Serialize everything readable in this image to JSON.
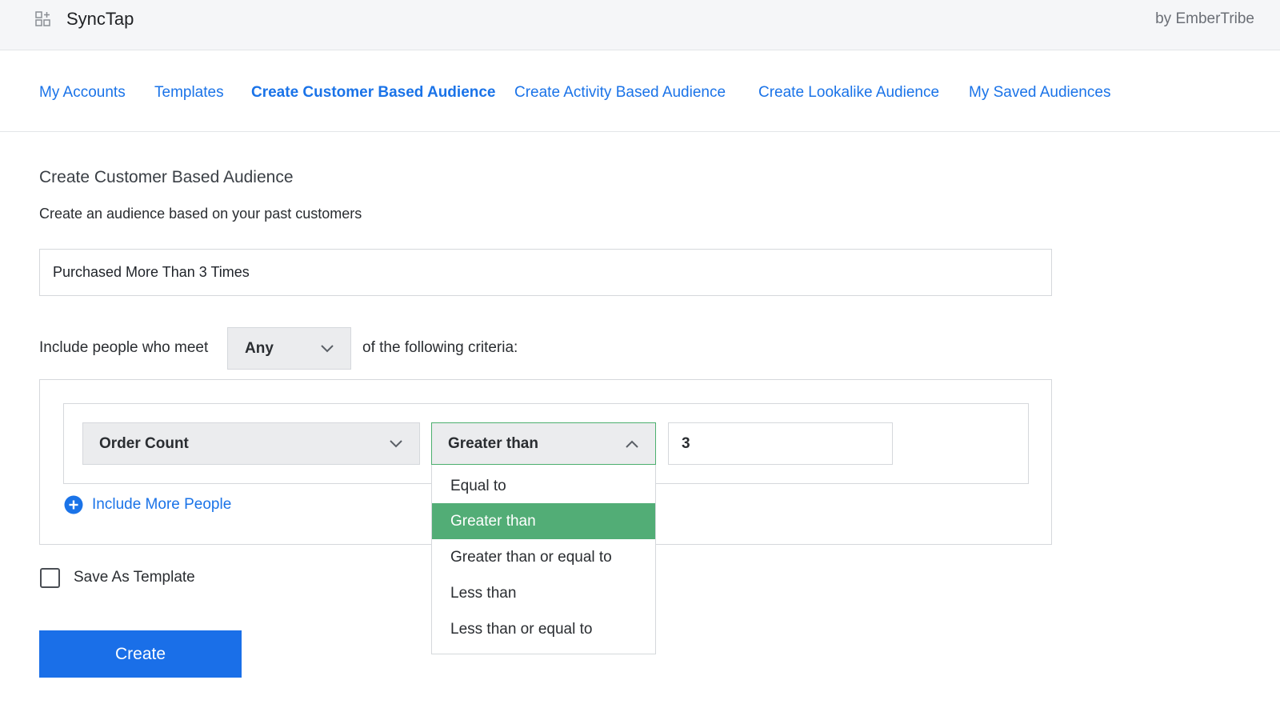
{
  "header": {
    "app_name": "SyncTap",
    "byline": "by EmberTribe",
    "app_icon": "grid-icon"
  },
  "nav": {
    "items": [
      {
        "label": "My Accounts",
        "active": false
      },
      {
        "label": "Templates",
        "active": false
      },
      {
        "label": "Create Customer Based Audience",
        "active": true
      },
      {
        "label": "Create Activity Based Audience",
        "active": false
      },
      {
        "label": "Create Lookalike Audience",
        "active": false
      },
      {
        "label": "My Saved Audiences",
        "active": false
      }
    ]
  },
  "form": {
    "heading": "Create Customer Based Audience",
    "subtext": "Create an audience based on your past customers",
    "audience_name_value": "Purchased More Than 3 Times",
    "include_prefix": "Include people who meet",
    "match_type": "Any",
    "include_suffix": "of the following criteria:",
    "rule": {
      "field": "Order Count",
      "operator": "Greater than",
      "value": "3",
      "operator_options": [
        {
          "label": "Equal to",
          "selected": false
        },
        {
          "label": "Greater than",
          "selected": true
        },
        {
          "label": "Greater than or equal to",
          "selected": false
        },
        {
          "label": "Less than",
          "selected": false
        },
        {
          "label": "Less than or equal to",
          "selected": false
        }
      ]
    },
    "include_more_label": "Include More People",
    "save_template_label": "Save As Template",
    "save_template_checked": false,
    "create_label": "Create"
  },
  "colors": {
    "link": "#1a73e8",
    "primary_button": "#1a6fe8",
    "selected_option": "#52ad76",
    "focus_border": "#4caf6e"
  }
}
